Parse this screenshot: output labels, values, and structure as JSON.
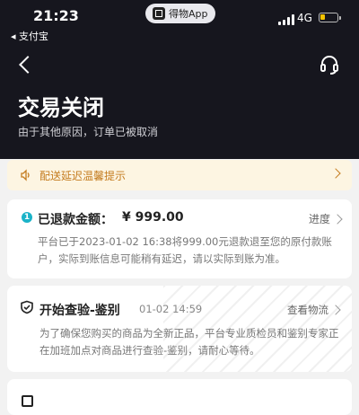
{
  "status_bar": {
    "time": "21:23",
    "back_app": "◂ 支付宝",
    "app_name": "得物App",
    "network": "4G",
    "battery_level": 0.3
  },
  "header": {
    "title": "交易关闭",
    "subtitle": "由于其他原因，订单已被取消"
  },
  "notice": {
    "text": "配送延迟温馨提示"
  },
  "refund": {
    "step": "1",
    "label": "已退款金额：",
    "amount": "¥ 999.00",
    "link": "进度",
    "description": "平台已于2023-01-02 16:38将999.00元退款退至您的原付款账户，实际到账信息可能稍有延迟，请以实际到账为准。"
  },
  "inspection": {
    "title": "开始查验-鉴别",
    "time": "01-02 14:59",
    "link": "查看物流",
    "description": "为了确保您购买的商品为全新正品，平台专业质检员和鉴别专家正在加班加点对商品进行查验-鉴别，请耐心等待。"
  },
  "colors": {
    "header_bg": "#16161e",
    "notice_bg": "#fdf5e2",
    "notice_text": "#c47b1e",
    "badge": "#1bb3c8"
  }
}
